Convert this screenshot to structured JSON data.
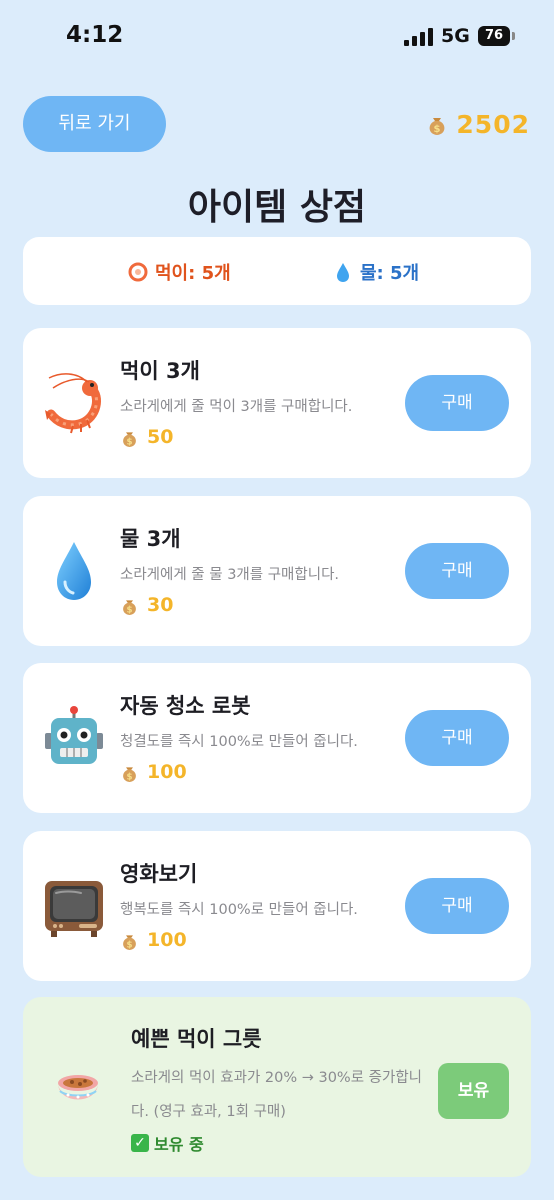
{
  "status_bar": {
    "time": "4:12",
    "network": "5G",
    "battery": "76"
  },
  "header": {
    "back_label": "뒤로 가기",
    "coins": "2502",
    "title": "아이템 상점"
  },
  "inventory": {
    "food": "먹이: 5개",
    "water": "물: 5개"
  },
  "items": [
    {
      "name": "먹이 3개",
      "description": "소라게에게 줄 먹이 3개를 구매합니다.",
      "price": "50",
      "button": "구매",
      "icon": "shrimp-icon"
    },
    {
      "name": "물 3개",
      "description": "소라게에게 줄 물 3개를 구매합니다.",
      "price": "30",
      "button": "구매",
      "icon": "water-drop-icon"
    },
    {
      "name": "자동 청소 로봇",
      "description": "청결도를 즉시 100%로 만들어 줍니다.",
      "price": "100",
      "button": "구매",
      "icon": "robot-icon"
    },
    {
      "name": "영화보기",
      "description": "행복도를 즉시 100%로 만들어 줍니다.",
      "price": "100",
      "button": "구매",
      "icon": "tv-icon"
    }
  ],
  "owned_item": {
    "name": "예쁜 먹이 그릇",
    "description": "소라게의 먹이 효과가 20% → 30%로 증가합니다. (영구 효과, 1회 구매)",
    "status": "보유 중",
    "button": "보유",
    "icon": "food-bowl-icon"
  },
  "colors": {
    "background": "#dcecfb",
    "accent": "#6fb6f4",
    "coin": "#f4b52a",
    "owned": "#7ccb7a"
  }
}
